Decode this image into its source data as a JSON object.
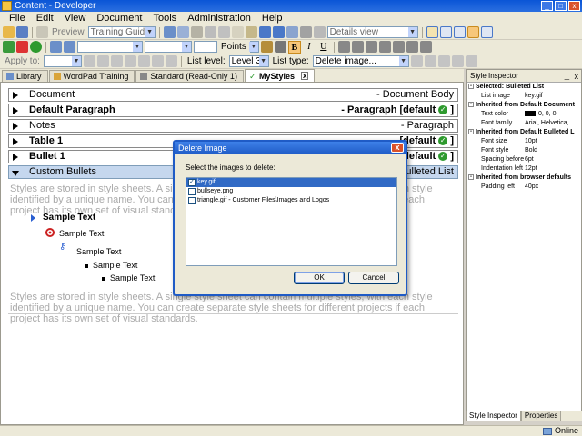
{
  "window": {
    "title": "Content - Developer"
  },
  "menu": [
    "File",
    "Edit",
    "View",
    "Document",
    "Tools",
    "Administration",
    "Help"
  ],
  "toolbar": {
    "preview_label": "Preview",
    "project_combo": "Training Guide",
    "view_combo": "Details view",
    "font_size_unit": "Points",
    "bold_label": "B",
    "italic_label": "I",
    "underline_label": "U",
    "apply_to_label": "Apply to:",
    "list_level_label": "List level:",
    "list_level_value": "Level 3",
    "list_type_label": "List type:",
    "list_type_value": "Delete image..."
  },
  "tabs": [
    {
      "label": "Library",
      "active": false
    },
    {
      "label": "WordPad Training",
      "active": false
    },
    {
      "label": "Standard (Read-Only 1)",
      "active": false
    },
    {
      "label": "MyStyles",
      "active": true
    }
  ],
  "styles": [
    {
      "name": "Document",
      "right": "- Document Body",
      "bold": false
    },
    {
      "name": "Default Paragraph",
      "right": "- Paragraph [default",
      "bold": true
    },
    {
      "name": "Notes",
      "right": "- Paragraph",
      "bold": false
    },
    {
      "name": "Table 1",
      "right": "[default",
      "bold": true
    },
    {
      "name": "Bullet 1",
      "right": "[default",
      "bold": true
    },
    {
      "name": "Custom Bullets",
      "right": "Bulleted List",
      "bold": false
    }
  ],
  "closing_bracket": "]",
  "help_text": "Styles are stored in style sheets. A single style sheet can contain multiple styles, with each style identified by a unique name. You can create separate style sheets for different projects if each project has its own set of visual standards.",
  "samples": [
    "Sample Text",
    "Sample Text",
    "Sample Text",
    "Sample Text",
    "Sample Text"
  ],
  "dialog": {
    "title": "Delete Image",
    "close_label": "x",
    "prompt": "Select the images to delete:",
    "items": [
      {
        "label": "key.gif",
        "checked": true,
        "selected": true
      },
      {
        "label": "bullseye.png",
        "checked": false,
        "selected": false
      },
      {
        "label": "triangle.gif - Customer Files\\Images and Logos",
        "checked": false,
        "selected": false
      }
    ],
    "ok_label": "OK",
    "cancel_label": "Cancel"
  },
  "inspector": {
    "title": "Style Inspector",
    "sections": [
      {
        "header": "Selected: Bulleted List",
        "props": [
          {
            "k": "List image",
            "v": "key.gif"
          }
        ]
      },
      {
        "header": "Inherited from Default Document",
        "props": [
          {
            "k": "Text color",
            "v": "0, 0, 0",
            "swatch": "#000000"
          },
          {
            "k": "Font family",
            "v": "Arial, Helvetica, ..."
          }
        ]
      },
      {
        "header": "Inherited from Default Bulleted L",
        "props": [
          {
            "k": "Font size",
            "v": "10pt"
          },
          {
            "k": "Font style",
            "v": "Bold"
          },
          {
            "k": "Spacing before",
            "v": "6pt"
          },
          {
            "k": "Indentation left",
            "v": "12pt"
          }
        ]
      },
      {
        "header": "Inherited from browser defaults",
        "props": [
          {
            "k": "Padding left",
            "v": "40px"
          }
        ]
      }
    ],
    "tabs": [
      "Style Inspector",
      "Properties"
    ]
  },
  "status": {
    "online_label": "Online"
  },
  "colors": {
    "title_blue": "#1f5bc6",
    "selection": "#316ac5",
    "check_green": "#2e9a2e"
  }
}
